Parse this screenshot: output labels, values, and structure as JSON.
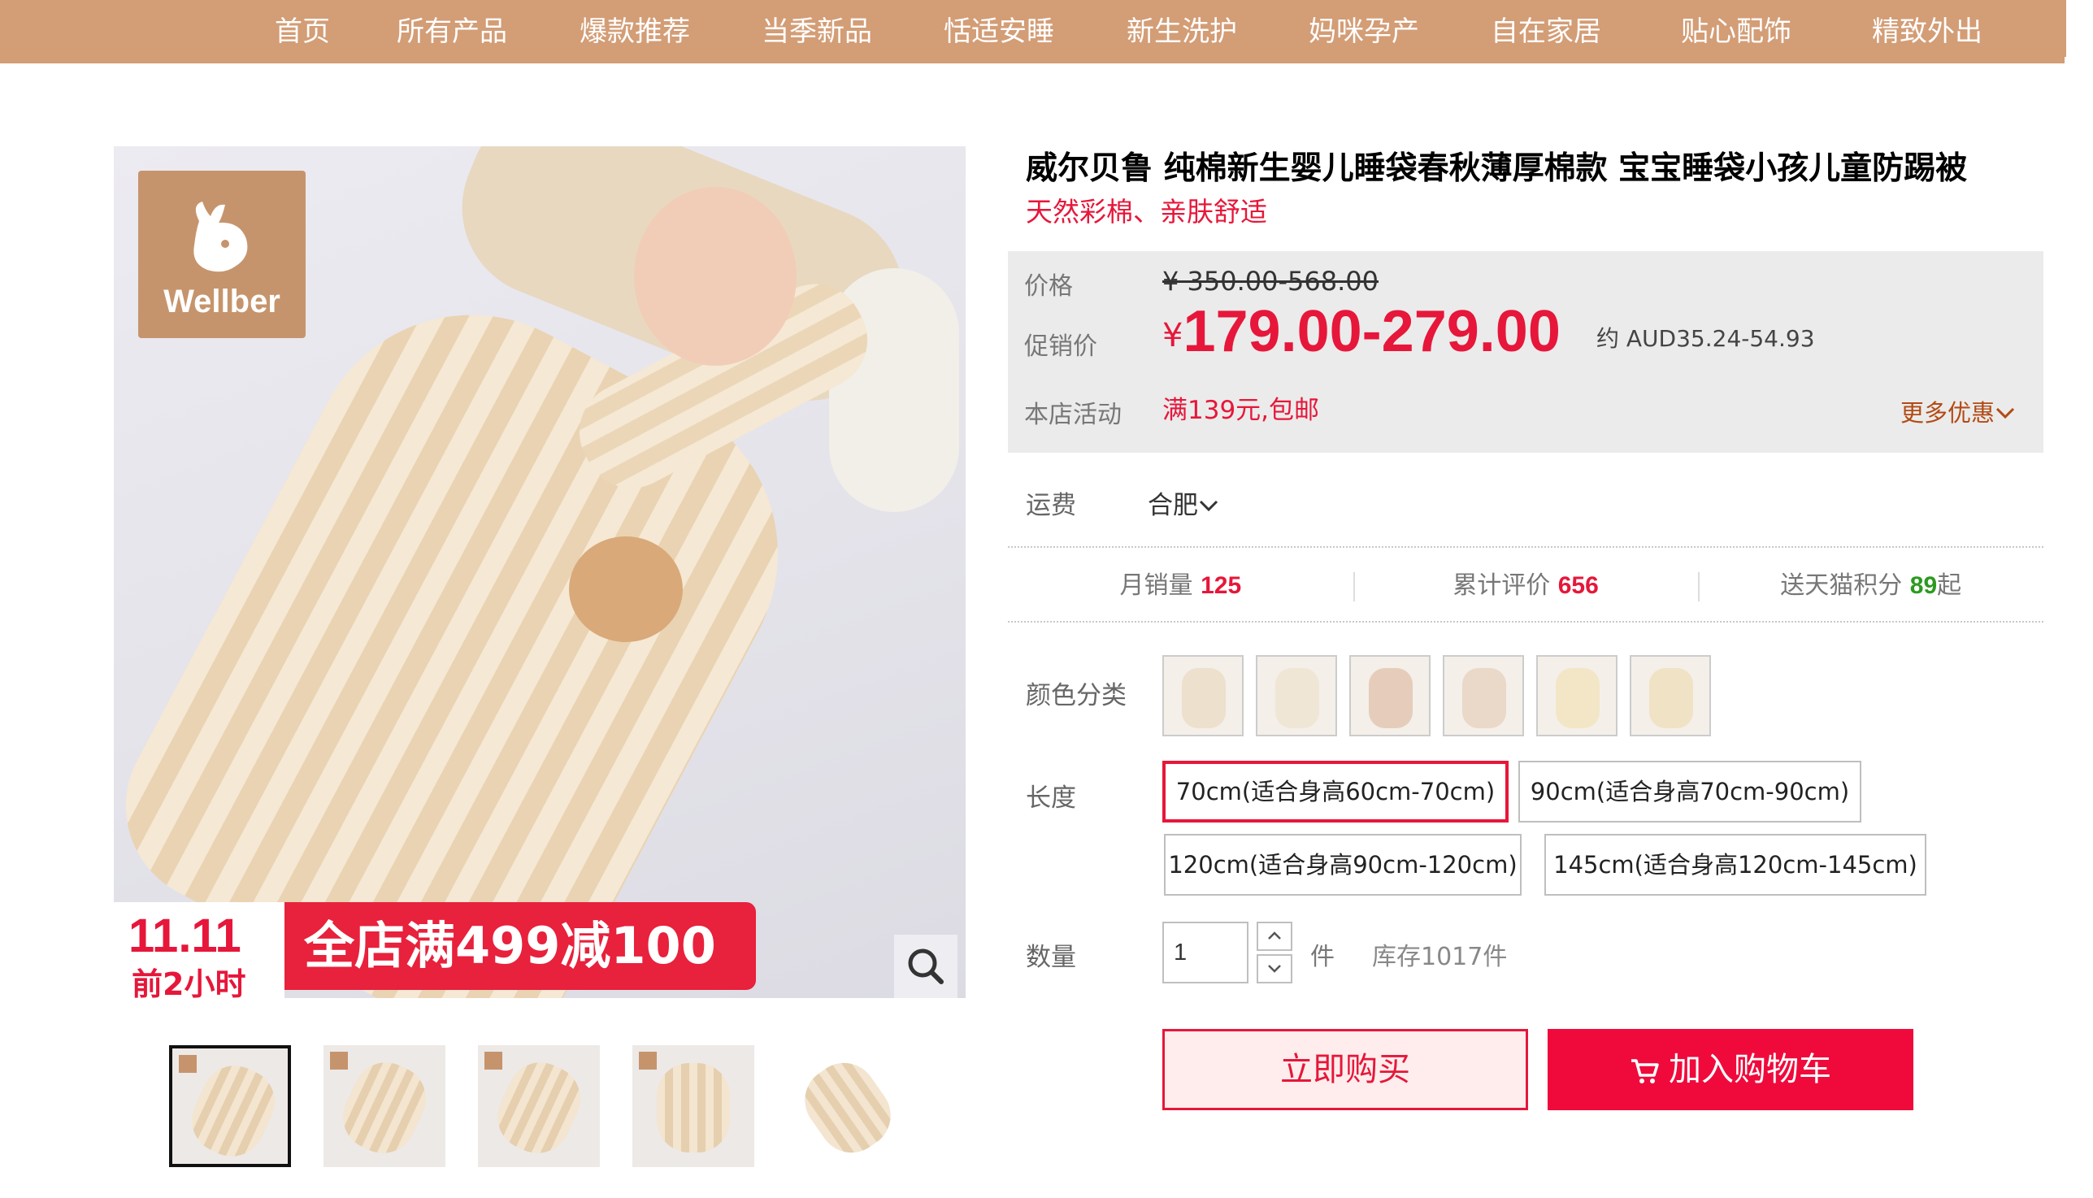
{
  "nav": {
    "items": [
      "首页",
      "所有产品",
      "爆款推荐",
      "当季新品",
      "恬适安睡",
      "新生洗护",
      "妈咪孕产",
      "自在家居",
      "贴心配饰",
      "精致外出"
    ]
  },
  "gallery": {
    "logo_text": "Wellber",
    "promo_date_line1": "11.11",
    "promo_date_line2": "前2小时",
    "promo_banner": "全店满499减100",
    "zoom_icon": "magnifier-icon",
    "thumbnail_count": 5
  },
  "product": {
    "title": "威尔贝鲁 纯棉新生婴儿睡袋春秋薄厚棉款 宝宝睡袋小孩儿童防踢被",
    "subtitle": "天然彩棉、亲肤舒适"
  },
  "price": {
    "label": "价格",
    "original": "¥ 350.00-568.00",
    "promo_label": "促销价",
    "currency": "¥",
    "promo_value": "179.00-279.00",
    "aud": "约 AUD35.24-54.93",
    "activity_label": "本店活动",
    "activity": "满139元,包邮",
    "more_label": "更多优惠"
  },
  "shipping": {
    "label": "运费",
    "city": "合肥"
  },
  "stats": {
    "monthly_sales_label": "月销量",
    "monthly_sales": "125",
    "reviews_label": "累计评价",
    "reviews": "656",
    "points_label": "送天猫积分",
    "points": "89",
    "points_suffix": "起"
  },
  "color": {
    "label": "颜色分类",
    "swatch_count": 6
  },
  "length": {
    "label": "长度",
    "options": [
      "70cm(适合身高60cm-70cm)",
      "90cm(适合身高70cm-90cm)",
      "120cm(适合身高90cm-120cm)",
      "145cm(适合身高120cm-145cm)"
    ],
    "selected": "70cm(适合身高60cm-70cm)"
  },
  "quantity": {
    "label": "数量",
    "value": "1",
    "unit": "件",
    "stock": "库存1017件"
  },
  "actions": {
    "buy_now": "立即购买",
    "add_to_cart": "加入购物车"
  },
  "colors": {
    "nav_bg": "#d39d76",
    "accent": "#e6173a",
    "cart_button": "#f00a3c",
    "price_panel": "#ebebeb"
  }
}
